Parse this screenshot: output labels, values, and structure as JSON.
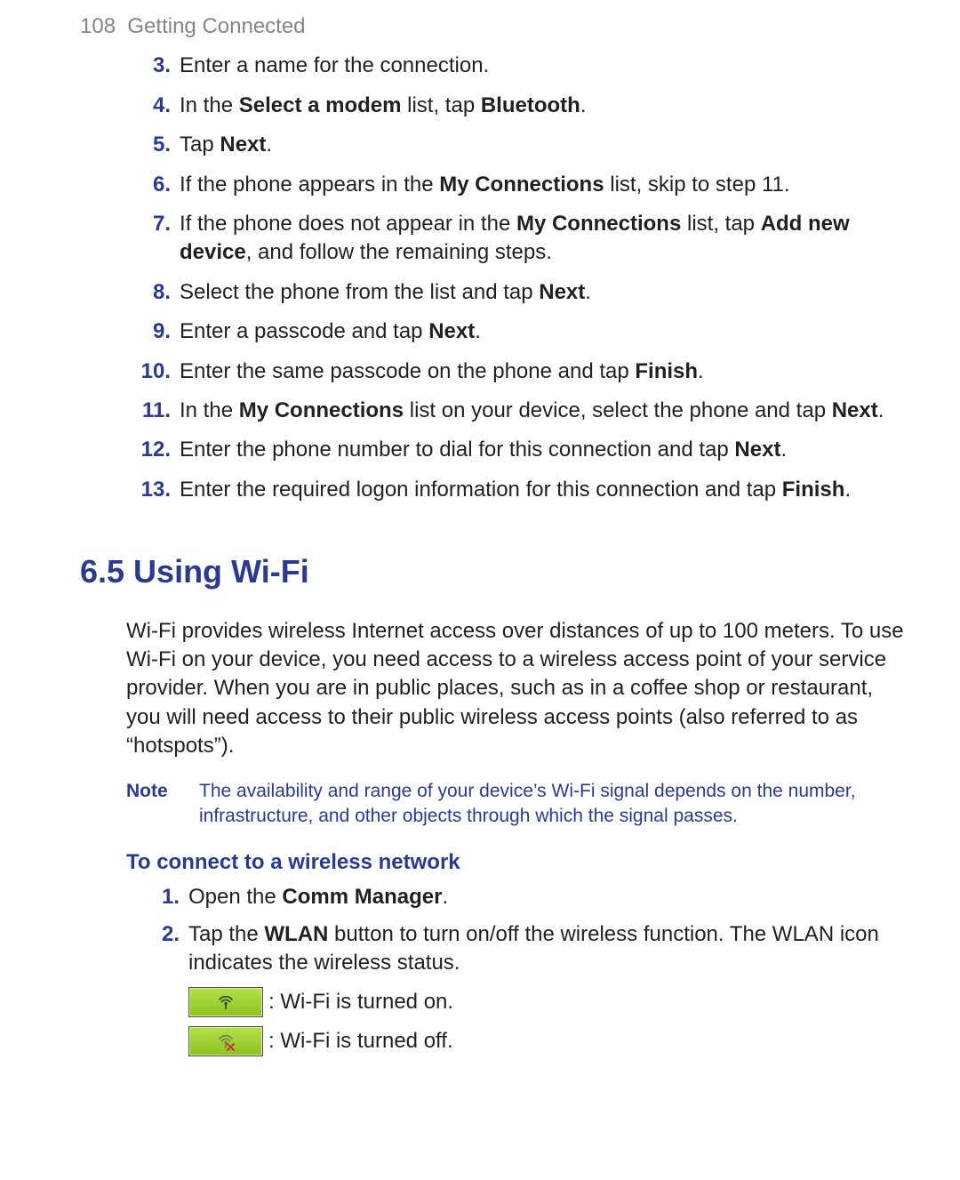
{
  "header": {
    "page_number": "108",
    "chapter_title": "Getting Connected"
  },
  "steps": [
    {
      "n": "3.",
      "parts": [
        {
          "t": "Enter a name for the connection."
        }
      ]
    },
    {
      "n": "4.",
      "parts": [
        {
          "t": "In the "
        },
        {
          "b": "Select a modem"
        },
        {
          "t": " list, tap "
        },
        {
          "b": "Bluetooth"
        },
        {
          "t": "."
        }
      ]
    },
    {
      "n": "5.",
      "parts": [
        {
          "t": "Tap "
        },
        {
          "b": "Next"
        },
        {
          "t": "."
        }
      ]
    },
    {
      "n": "6.",
      "parts": [
        {
          "t": "If the phone appears in the "
        },
        {
          "b": "My Connections"
        },
        {
          "t": " list, skip to step 11."
        }
      ]
    },
    {
      "n": "7.",
      "parts": [
        {
          "t": "If the phone does not appear in the "
        },
        {
          "b": "My Connections"
        },
        {
          "t": " list, tap "
        },
        {
          "b": "Add new device"
        },
        {
          "t": ", and follow the remaining steps."
        }
      ]
    },
    {
      "n": "8.",
      "parts": [
        {
          "t": "Select the phone from the list and tap "
        },
        {
          "b": "Next"
        },
        {
          "t": "."
        }
      ]
    },
    {
      "n": "9.",
      "parts": [
        {
          "t": "Enter a passcode and tap "
        },
        {
          "b": "Next"
        },
        {
          "t": "."
        }
      ]
    },
    {
      "n": "10.",
      "parts": [
        {
          "t": "Enter the same passcode on the phone and tap "
        },
        {
          "b": "Finish"
        },
        {
          "t": "."
        }
      ]
    },
    {
      "n": "11.",
      "parts": [
        {
          "t": "In the "
        },
        {
          "b": "My Connections"
        },
        {
          "t": " list on your device, select the phone and tap "
        },
        {
          "b": "Next"
        },
        {
          "t": "."
        }
      ]
    },
    {
      "n": "12.",
      "parts": [
        {
          "t": "Enter the phone number to dial for this connection and tap "
        },
        {
          "b": "Next"
        },
        {
          "t": "."
        }
      ]
    },
    {
      "n": "13.",
      "parts": [
        {
          "t": "Enter the required logon information for this connection and tap "
        },
        {
          "b": "Finish"
        },
        {
          "t": "."
        }
      ]
    }
  ],
  "section_heading": "6.5 Using Wi-Fi",
  "intro_paragraph": "Wi-Fi provides wireless Internet access over distances of up to 100 meters. To use Wi-Fi on your device, you need access to a wireless access point of your service provider. When you are in public places, such as in a coffee shop or restaurant, you will need access to their public wireless access points (also referred to as “hotspots”).",
  "note": {
    "label": "Note",
    "body": "The availability and range of your device’s Wi-Fi signal depends on the number, infrastructure, and other objects through which the signal passes."
  },
  "subhead": "To connect to a wireless network",
  "substeps": [
    {
      "n": "1.",
      "parts": [
        {
          "t": "Open the "
        },
        {
          "b": "Comm Manager"
        },
        {
          "t": "."
        }
      ]
    },
    {
      "n": "2.",
      "parts": [
        {
          "t": "Tap the "
        },
        {
          "b": "WLAN"
        },
        {
          "t": " button to turn on/off the wireless function. The WLAN icon indicates the wireless status."
        }
      ]
    }
  ],
  "icon_lines": {
    "on": ": Wi-Fi is turned on.",
    "off": ": Wi-Fi is turned off."
  }
}
